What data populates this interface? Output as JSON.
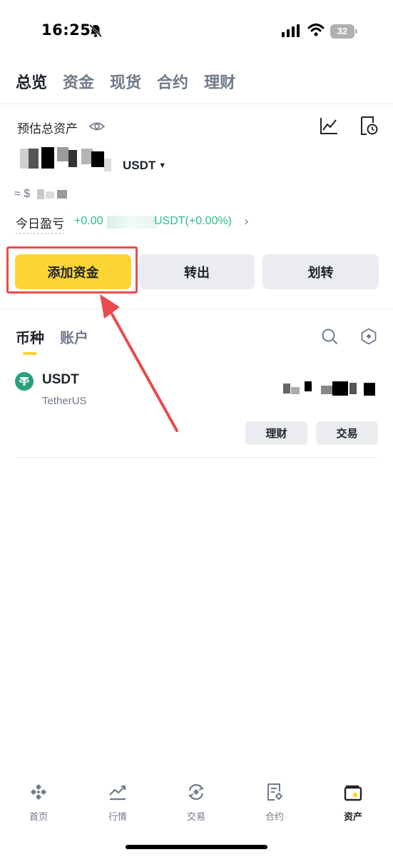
{
  "status_bar": {
    "time": "16:25",
    "battery": "32"
  },
  "top_tabs": [
    {
      "label": "总览",
      "active": true
    },
    {
      "label": "资金",
      "active": false
    },
    {
      "label": "现货",
      "active": false
    },
    {
      "label": "合约",
      "active": false
    },
    {
      "label": "理财",
      "active": false
    }
  ],
  "summary": {
    "title": "预估总资产",
    "currency": "USDT",
    "approx_prefix": "≈ $",
    "pnl_label": "今日盈亏",
    "pnl_value": "+0.00",
    "pnl_value_suffix": "USDT(+0.00%)"
  },
  "actions": {
    "add_funds": "添加资金",
    "transfer_out": "转出",
    "transfer": "划转"
  },
  "coin_tabs": [
    {
      "label": "币种",
      "active": true
    },
    {
      "label": "账户",
      "active": false
    }
  ],
  "coin": {
    "symbol": "USDT",
    "name": "TetherUS",
    "logo_char": "₮",
    "earn_label": "理财",
    "trade_label": "交易"
  },
  "bottom_nav": [
    {
      "label": "首页",
      "icon": "home-icon",
      "active": false
    },
    {
      "label": "行情",
      "icon": "markets-icon",
      "active": false
    },
    {
      "label": "交易",
      "icon": "trade-icon",
      "active": false
    },
    {
      "label": "合约",
      "icon": "futures-icon",
      "active": false
    },
    {
      "label": "资产",
      "icon": "wallet-icon",
      "active": true
    }
  ],
  "colors": {
    "accent": "#fcd535",
    "positive": "#2ebd85",
    "annotation": "#e84c4c",
    "tether": "#26a17b"
  }
}
